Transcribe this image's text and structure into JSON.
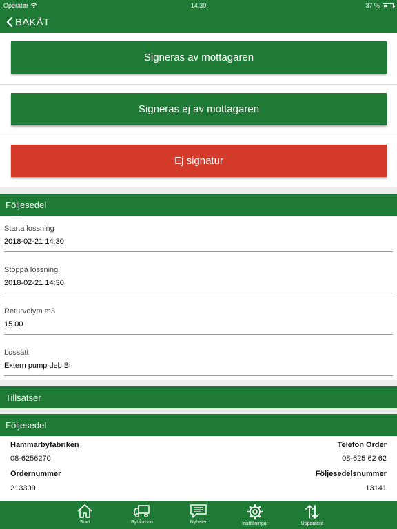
{
  "status_bar": {
    "carrier": "Operatør",
    "time": "14.30",
    "battery": "37 %"
  },
  "nav": {
    "back_label": "BAKÅT"
  },
  "actions": {
    "signed_by_recipient": "Signeras av mottagaren",
    "not_signed_by_recipient": "Signeras ej av mottagaren",
    "no_signature": "Ej signatur"
  },
  "sections": {
    "foljesedel_1": "Följesedel",
    "tillsatser": "Tillsatser",
    "foljesedel_2": "Följesedel"
  },
  "form": {
    "fields": [
      {
        "label": "Starta lossning",
        "value": "2018-02-21 14:30"
      },
      {
        "label": "Stoppa lossning",
        "value": "2018-02-21 14:30"
      },
      {
        "label": "Returvolym m3",
        "value": "15.00"
      },
      {
        "label": "Lossätt",
        "value": "Extern pump deb Bl"
      }
    ]
  },
  "details": {
    "company": "Hammarbyfabriken",
    "phone_order_label": "Telefon Order",
    "company_phone": "08-6256270",
    "phone_order_value": "08-625 62 62",
    "order_number_label": "Ordernummer",
    "delivery_note_number_label": "Följesedelsnummer",
    "order_number": "213309",
    "delivery_note_number": "13141"
  },
  "tabbar": {
    "start": "Start",
    "switch_vehicle": "Byt fordon",
    "news": "Nyheter",
    "settings": "Inställningar",
    "update": "Uppdatera"
  },
  "colors": {
    "brand_green": "#1f7a35",
    "danger_red": "#d33a2a"
  }
}
